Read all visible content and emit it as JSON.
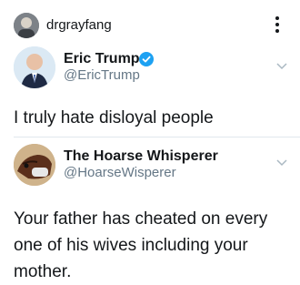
{
  "header": {
    "username": "drgrayfang",
    "menu_icon": "kebab-menu-icon"
  },
  "tweets": [
    {
      "name": "Eric Trump",
      "handle": "@EricTrump",
      "verified": true,
      "text": "I truly hate disloyal people"
    },
    {
      "name": "The Hoarse Whisperer",
      "handle": "@HoarseWisperer",
      "verified": false,
      "text": "Your father has cheated on every one of his wives including your mother."
    }
  ],
  "colors": {
    "verified": "#1da1f2",
    "handle": "#657786",
    "divider": "#e1e8ed"
  }
}
